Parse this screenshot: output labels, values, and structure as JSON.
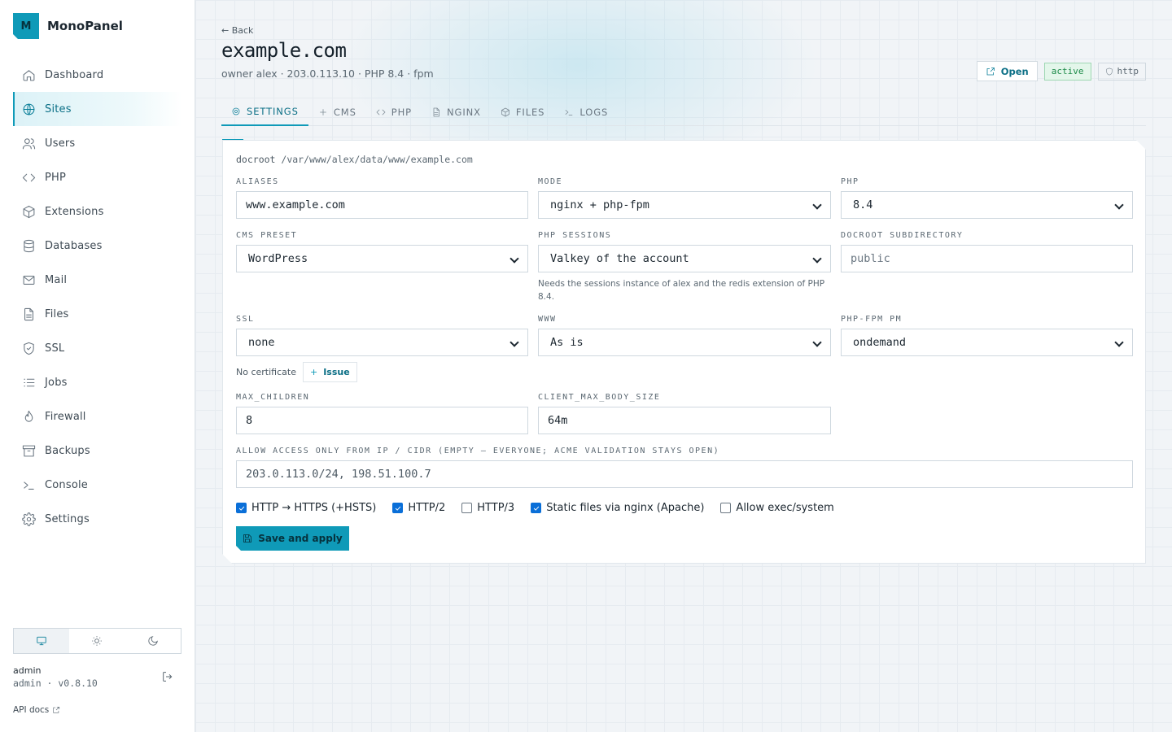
{
  "brand": {
    "logo_letter": "M",
    "name": "MonoPanel"
  },
  "sidebar": {
    "items": [
      {
        "label": "Dashboard",
        "icon": "home-icon"
      },
      {
        "label": "Sites",
        "icon": "globe-icon",
        "active": true
      },
      {
        "label": "Users",
        "icon": "users-icon"
      },
      {
        "label": "PHP",
        "icon": "code-icon"
      },
      {
        "label": "Extensions",
        "icon": "package-icon"
      },
      {
        "label": "Databases",
        "icon": "database-icon"
      },
      {
        "label": "Mail",
        "icon": "mail-icon"
      },
      {
        "label": "Files",
        "icon": "file-icon"
      },
      {
        "label": "SSL",
        "icon": "shield-icon"
      },
      {
        "label": "Jobs",
        "icon": "list-icon"
      },
      {
        "label": "Firewall",
        "icon": "flame-icon"
      },
      {
        "label": "Backups",
        "icon": "archive-icon"
      },
      {
        "label": "Console",
        "icon": "terminal-icon"
      },
      {
        "label": "Settings",
        "icon": "gear-icon"
      }
    ],
    "theme_options": [
      "monitor-icon",
      "sun-icon",
      "moon-icon"
    ],
    "user": {
      "name": "admin",
      "meta": "admin · v0.8.10"
    },
    "api_docs": "API docs"
  },
  "header": {
    "back": "← Back",
    "title": "example.com",
    "subtitle": "owner alex · 203.0.113.10 · PHP 8.4 · fpm",
    "open_label": "Open",
    "status_badge": "active",
    "protocol_badge": "http"
  },
  "tabs": [
    {
      "label": "SETTINGS",
      "icon": "gear-icon",
      "active": true
    },
    {
      "label": "CMS",
      "icon": "plus-icon"
    },
    {
      "label": "PHP",
      "icon": "code-icon"
    },
    {
      "label": "NGINX",
      "icon": "file-icon"
    },
    {
      "label": "FILES",
      "icon": "package-icon"
    },
    {
      "label": "LOGS",
      "icon": "terminal-icon"
    }
  ],
  "form": {
    "docroot_label": "docroot",
    "docroot_value": "/var/www/alex/data/www/example.com",
    "aliases": {
      "label": "ALIASES",
      "value": "www.example.com"
    },
    "mode": {
      "label": "MODE",
      "value": "nginx + php-fpm"
    },
    "php": {
      "label": "PHP",
      "value": "8.4"
    },
    "cms_preset": {
      "label": "CMS PRESET",
      "value": "WordPress"
    },
    "php_sessions": {
      "label": "PHP SESSIONS",
      "value": "Valkey of the account",
      "hint": "Needs the sessions instance of alex and the redis extension of PHP 8.4."
    },
    "docroot_subdir": {
      "label": "DOCROOT SUBDIRECTORY",
      "placeholder": "public"
    },
    "ssl": {
      "label": "SSL",
      "value": "none",
      "status": "No certificate",
      "issue_label": "Issue"
    },
    "www": {
      "label": "WWW",
      "value": "As is"
    },
    "fpm_pm": {
      "label": "PHP-FPM PM",
      "value": "ondemand"
    },
    "max_children": {
      "label": "MAX_CHILDREN",
      "value": "8"
    },
    "client_max_body_size": {
      "label": "CLIENT_MAX_BODY_SIZE",
      "value": "64m"
    },
    "allow_access": {
      "label": "ALLOW ACCESS ONLY FROM IP / CIDR (EMPTY — EVERYONE; ACME VALIDATION STAYS OPEN)",
      "value": "203.0.113.0/24, 198.51.100.7"
    },
    "checkboxes": [
      {
        "label": "HTTP → HTTPS (+HSTS)",
        "checked": true
      },
      {
        "label": "HTTP/2",
        "checked": true
      },
      {
        "label": "HTTP/3",
        "checked": false
      },
      {
        "label": "Static files via nginx (Apache)",
        "checked": true
      },
      {
        "label": "Allow exec/system",
        "checked": false
      }
    ],
    "save_label": "Save and apply"
  },
  "colors": {
    "accent": "#0f9ab8",
    "active_badge": "#1c8a48",
    "checkbox": "#0a6fd8"
  }
}
